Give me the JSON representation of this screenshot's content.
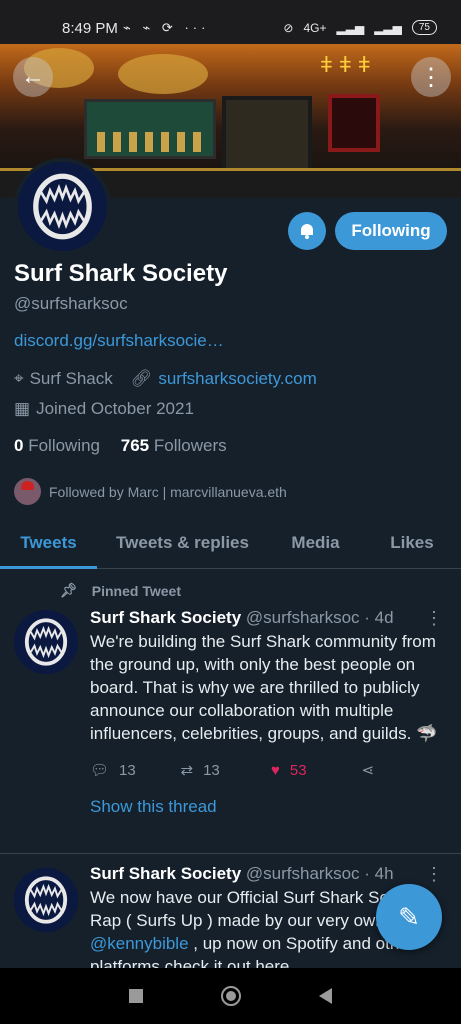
{
  "status_bar": {
    "time": "8:49 PM",
    "left_icons": [
      "gamepad-icon",
      "gamepad-icon",
      "sync-icon",
      "more-dots-icon"
    ],
    "network": "4G+",
    "battery": "75"
  },
  "header": {
    "back_icon": "arrow-left-icon",
    "overflow_icon": "more-vertical-icon"
  },
  "profile": {
    "name": "Surf Shark Society",
    "handle": "@surfsharksoc",
    "bio_link": "discord.gg/surfsharksocie…",
    "location": "Surf Shack",
    "website": "surfsharksociety.com",
    "joined": "Joined October 2021",
    "following_count": "0",
    "following_label": "Following",
    "followers_count": "765",
    "followers_label": "Followers",
    "followed_by": "Followed by Marc | marcvillanueva.eth",
    "follow_button": "Following"
  },
  "tabs": [
    {
      "label": "Tweets",
      "active": true
    },
    {
      "label": "Tweets & replies"
    },
    {
      "label": "Media"
    },
    {
      "label": "Likes"
    }
  ],
  "tweets": [
    {
      "pinned_label": "Pinned Tweet",
      "name": "Surf Shark Society",
      "handle": "@surfsharksoc",
      "time": "· 4d",
      "text": "We're building the Surf Shark community from the ground up, with only the best people on board. That is why we are thrilled to publicly announce our collaboration with multiple influencers, celebrities,  groups, and guilds. 🦈",
      "replies": "13",
      "retweets": "13",
      "likes": "53",
      "show_thread": "Show this thread"
    },
    {
      "name": "Surf Shark Society",
      "handle": "@surfsharksoc",
      "time": "· 4h",
      "text_before": "We now have our Official Surf Shark Society Rap ( Surfs Up ) made by our very own ",
      "mention": "@kennybible",
      "text_after": " , up now on Spotify and other platforms check it out here"
    }
  ],
  "colors": {
    "background": "#15202b",
    "accent": "#3d98d8",
    "like": "#e0245e",
    "muted": "#8b98a5"
  }
}
